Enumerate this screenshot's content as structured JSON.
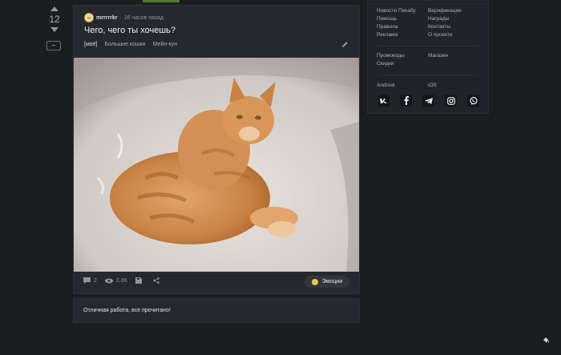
{
  "vote": {
    "count": "12",
    "collapse_symbol": "−"
  },
  "story": {
    "author": "mrrrrrkr",
    "time": "16 часов назад",
    "title": "Чего, чего ты хочешь?",
    "tags": [
      "[моё]",
      "Большие кошки",
      "Мейн-кун"
    ],
    "comments": "2",
    "views": "2.6K",
    "emotion_label": "Эмоции"
  },
  "done_message": "Отличная работа, все прочитано!",
  "sidebar": {
    "links_left": [
      "Новости Пикабу",
      "Помощь",
      "Правила",
      "Реклама"
    ],
    "links_right": [
      "Верификации",
      "Награды",
      "Контакты",
      "О проекте"
    ],
    "promo_left": [
      "Промокоды",
      "Скидки"
    ],
    "promo_right": [
      "Магазин"
    ],
    "apps": [
      "Android",
      "iOS"
    ],
    "social_icons": [
      "vk-icon",
      "facebook-icon",
      "telegram-icon",
      "instagram-icon",
      "viber-icon"
    ]
  },
  "colors": {
    "background": "#1b1e21",
    "card": "#25292d",
    "accent": "#4f7a34"
  }
}
